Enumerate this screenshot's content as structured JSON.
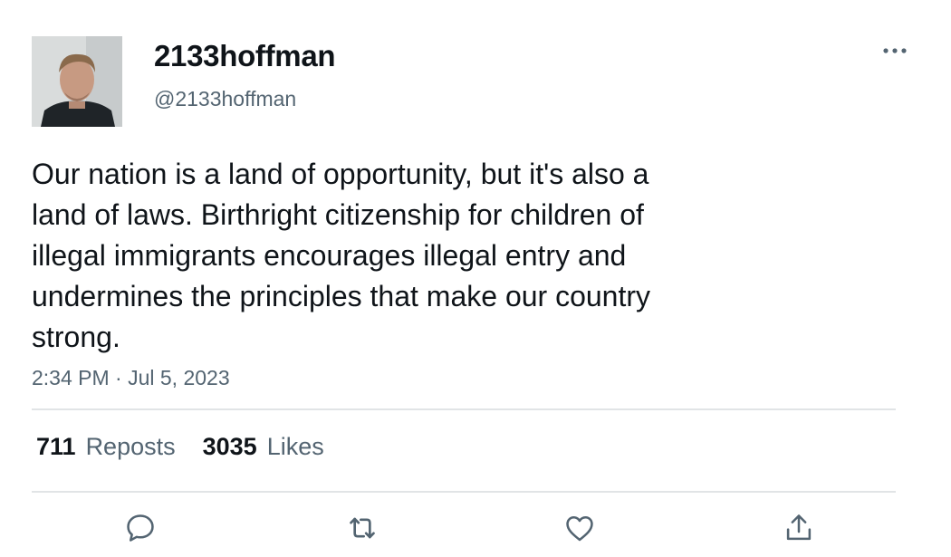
{
  "author": {
    "display_name": "2133hoffman",
    "handle": "@2133hoffman",
    "avatar": "profile-photo"
  },
  "more_icon": "more-horizontal-icon",
  "tweet": {
    "text": "Our nation is a land of opportunity, but it's also a\nland of laws. Birthright citizenship for children of\nillegal immigrants encourages illegal entry and\nundermines the principles that make our country\nstrong.",
    "timestamp": "2:34 PM · Jul 5, 2023"
  },
  "stats": {
    "reposts_count": "711",
    "reposts_label": "Reposts",
    "likes_count": "3035",
    "likes_label": "Likes"
  },
  "actions": [
    "reply-icon",
    "repost-icon",
    "like-icon",
    "share-icon"
  ],
  "colors": {
    "text_primary": "#0f1419",
    "text_secondary": "#536471",
    "divider": "#e1e4e6",
    "icon": "#536471"
  }
}
